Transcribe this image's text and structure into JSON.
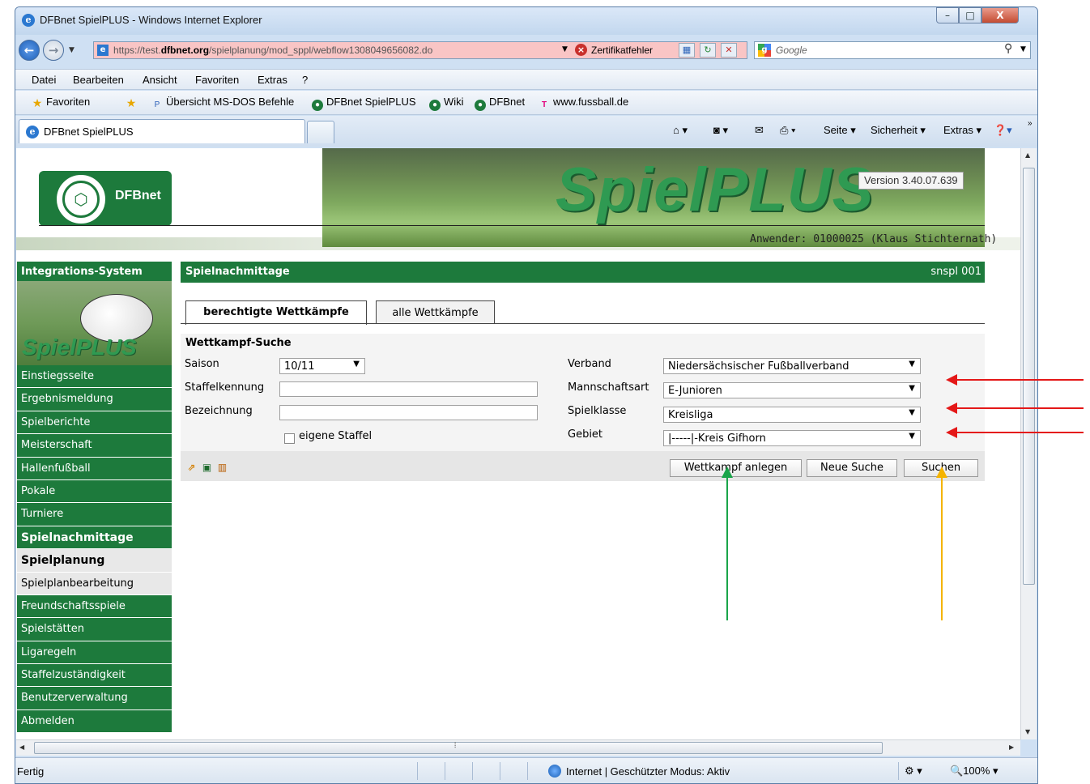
{
  "window": {
    "title": "DFBnet SpielPLUS - Windows Internet Explorer",
    "min_glyph": "–",
    "max_glyph": "□",
    "close_glyph": "X"
  },
  "address": {
    "url_prefix": "https://test.",
    "url_domain": "dfbnet.org",
    "url_path": "/spielplanung/mod_sppl/webflow1308049656082.do",
    "cert_error": "Zertifikatfehler",
    "search_placeholder": "Google"
  },
  "menu": [
    "Datei",
    "Bearbeiten",
    "Ansicht",
    "Favoriten",
    "Extras",
    "?"
  ],
  "favorites": {
    "label": "Favoriten",
    "items": [
      "Übersicht MS-DOS Befehle",
      "DFBnet SpielPLUS",
      "Wiki",
      "DFBnet",
      "www.fussball.de"
    ]
  },
  "tab": {
    "label": "DFBnet SpielPLUS",
    "commands": [
      "Seite ▾",
      "Sicherheit ▾",
      "Extras ▾"
    ]
  },
  "status": {
    "text": "Fertig",
    "zone": "Internet | Geschützter Modus: Aktiv",
    "zoom": "100%"
  },
  "page": {
    "logo_text": "DFBnet",
    "banner_title": "SpielPLUS",
    "version": "Version 3.40.07.639",
    "user": "Anwender: 01000025 (Klaus Stichternath)",
    "sidebar": {
      "header": "Integrations-System",
      "brand": "SpielPLUS",
      "items": [
        "Einstiegsseite",
        "Ergebnismeldung",
        "Spielberichte",
        "Meisterschaft",
        "Hallenfußball",
        "Pokale",
        "Turniere",
        "Spielnachmittage",
        "Spielplanung",
        "Spielplanbearbeitung",
        "Freundschaftsspiele",
        "Spielstätten",
        "Ligaregeln",
        "Staffelzuständigkeit",
        "Benutzerverwaltung",
        "Abmelden"
      ]
    },
    "main": {
      "title": "Spielnachmittage",
      "code": "snspl 001",
      "tabs": [
        "berechtigte Wettkämpfe",
        "alle Wettkämpfe"
      ],
      "form": {
        "title": "Wettkampf-Suche",
        "saison_label": "Saison",
        "saison_value": "10/11",
        "staffelkennung_label": "Staffelkennung",
        "bezeichnung_label": "Bezeichnung",
        "eigene_staffel_label": "eigene Staffel",
        "verband_label": "Verband",
        "verband_value": "Niedersächsischer Fußballverband",
        "mannschaftsart_label": "Mannschaftsart",
        "mannschaftsart_value": "E-Junioren",
        "spielklasse_label": "Spielklasse",
        "spielklasse_value": "Kreisliga",
        "gebiet_label": "Gebiet",
        "gebiet_value": "|-----|-Kreis Gifhorn"
      },
      "buttons": {
        "anlegen": "Wettkampf anlegen",
        "neue_suche": "Neue Suche",
        "suchen": "Suchen"
      }
    }
  },
  "annotation_colors": {
    "red": "#e41818",
    "green": "#1aa54a",
    "orange": "#f5b400"
  }
}
